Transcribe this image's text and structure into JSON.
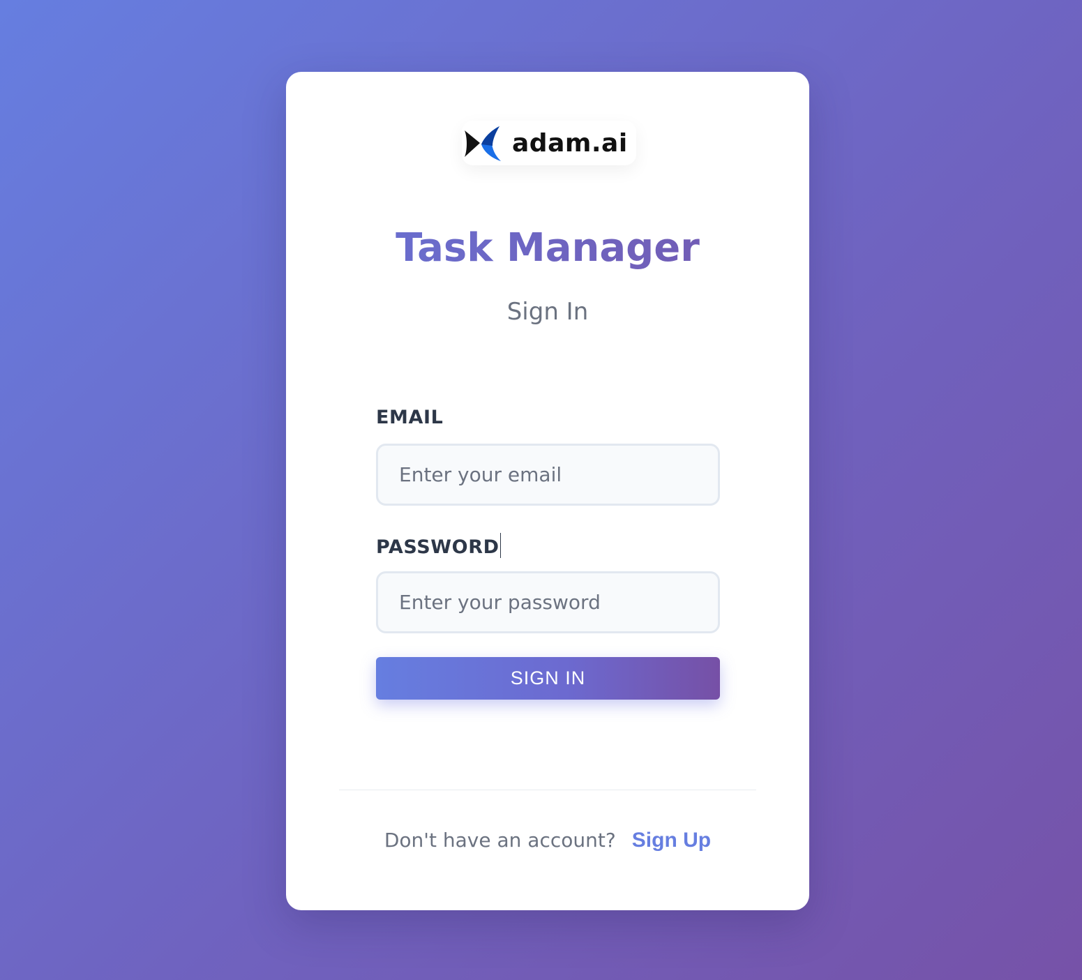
{
  "brand": {
    "name": "adam.ai",
    "logo_icon": "adam-ai-logo-icon"
  },
  "login": {
    "title": "Task Manager",
    "subtitle": "Sign In",
    "email_label": "EMAIL",
    "email_placeholder": "Enter your email",
    "email_value": "",
    "password_label": "PASSWORD",
    "password_placeholder": "Enter your password",
    "password_value": "",
    "submit_label": "SIGN IN"
  },
  "footer": {
    "prompt": "Don't have an account?",
    "link_label": "Sign Up"
  },
  "colors": {
    "accent": "#667ee0",
    "accent_end": "#764ba2",
    "background_start": "#667ee0",
    "background_end": "#7652a8",
    "card": "#ffffff"
  }
}
